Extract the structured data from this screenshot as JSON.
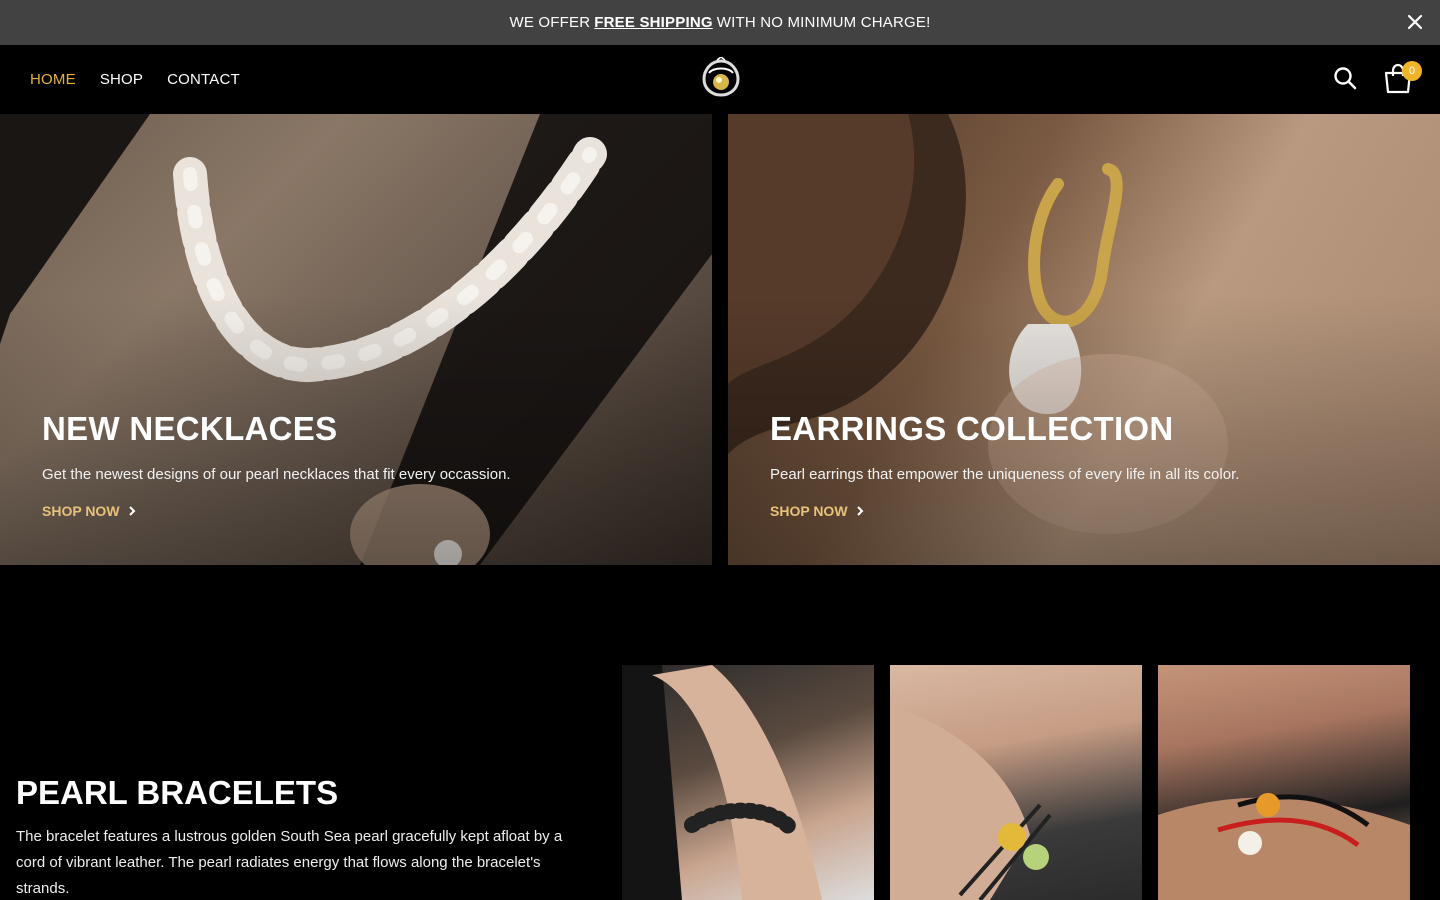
{
  "announcement": {
    "prefix": "WE OFFER",
    "highlight": "FREE SHIPPING",
    "suffix": "WITH NO MINIMUM CHARGE!",
    "close_icon": "close-icon"
  },
  "nav": {
    "items": [
      {
        "label": "HOME",
        "active": true
      },
      {
        "label": "SHOP",
        "active": false
      },
      {
        "label": "CONTACT",
        "active": false
      }
    ]
  },
  "header": {
    "search_icon": "search-icon",
    "cart_icon": "shopping-bag-icon",
    "cart_count": "0"
  },
  "banners": [
    {
      "title": "NEW NECKLACES",
      "description": "Get the newest designs of our pearl necklaces that fit every occassion.",
      "cta": "SHOP NOW"
    },
    {
      "title": "EARRINGS COLLECTION",
      "description": "Pearl earrings that empower the uniqueness of every life in all its color.",
      "cta": "SHOP NOW"
    }
  ],
  "bracelets": {
    "title": "PEARL BRACELETS",
    "description": "The bracelet features a lustrous golden South Sea pearl gracefully kept afloat by a cord of vibrant leather. The pearl radiates energy that flows along the bracelet's strands."
  },
  "colors": {
    "accent": "#e8b23a",
    "cta": "#e8c27a",
    "badge": "#f0b429",
    "announcement_bg": "#424242"
  }
}
